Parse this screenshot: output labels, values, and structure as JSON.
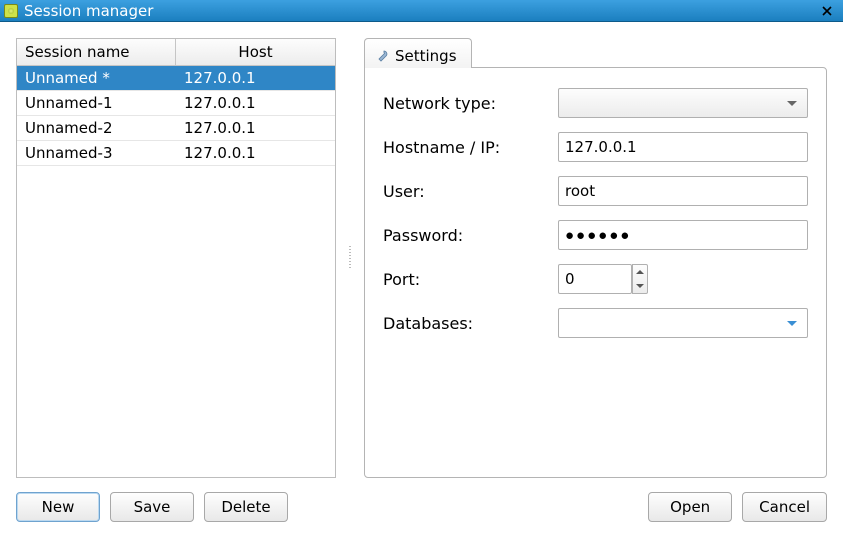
{
  "window": {
    "title": "Session manager"
  },
  "session_table": {
    "columns": {
      "name": "Session name",
      "host": "Host"
    },
    "rows": [
      {
        "name": "Unnamed *",
        "host": "127.0.0.1",
        "selected": true
      },
      {
        "name": "Unnamed-1",
        "host": "127.0.0.1",
        "selected": false
      },
      {
        "name": "Unnamed-2",
        "host": "127.0.0.1",
        "selected": false
      },
      {
        "name": "Unnamed-3",
        "host": "127.0.0.1",
        "selected": false
      }
    ]
  },
  "tabs": {
    "settings_label": "Settings"
  },
  "form": {
    "network_type_label": "Network type:",
    "network_type_value": "",
    "hostname_label": "Hostname / IP:",
    "hostname_value": "127.0.0.1",
    "user_label": "User:",
    "user_value": "root",
    "password_label": "Password:",
    "password_value": "●●●●●●",
    "port_label": "Port:",
    "port_value": "0",
    "databases_label": "Databases:",
    "databases_value": ""
  },
  "buttons": {
    "new": "New",
    "save": "Save",
    "delete": "Delete",
    "open": "Open",
    "cancel": "Cancel"
  }
}
